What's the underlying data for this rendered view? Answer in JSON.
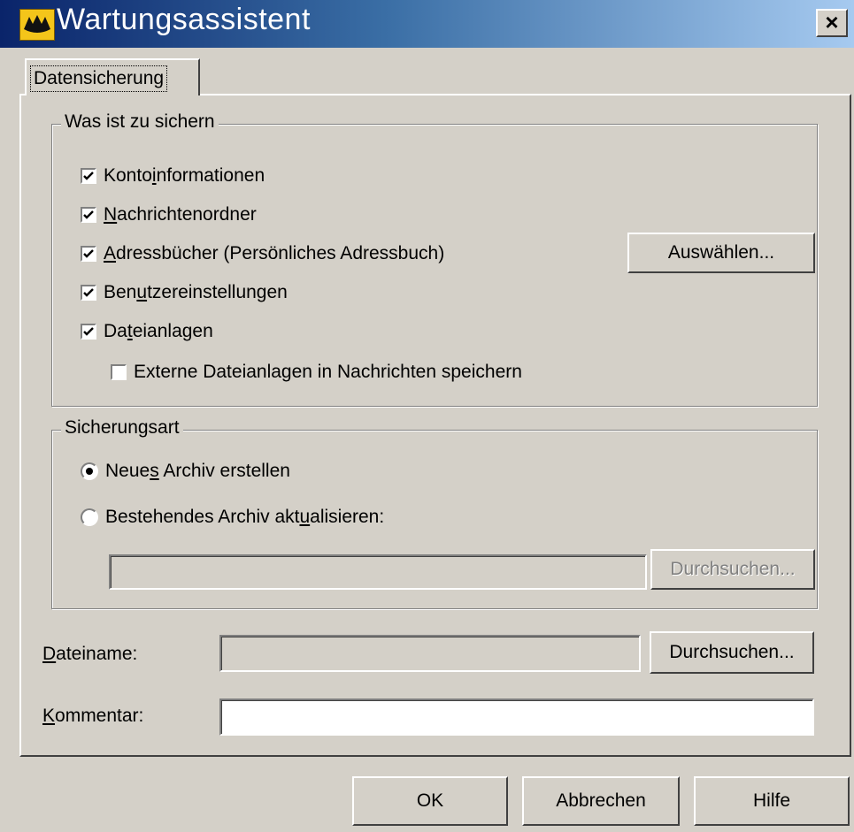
{
  "window": {
    "title": "Wartungsassistent",
    "close_label": "×"
  },
  "tab": {
    "label": "Datensicherung"
  },
  "what_group": {
    "legend": "Was ist zu sichern",
    "items": [
      {
        "pre": "Konto",
        "key": "i",
        "post": "nformationen",
        "checked": true
      },
      {
        "pre": "",
        "key": "N",
        "post": "achrichtenordner",
        "checked": true
      },
      {
        "pre": "",
        "key": "A",
        "post": "dressbücher (Persönliches Adressbuch)",
        "checked": true
      },
      {
        "pre": "Ben",
        "key": "u",
        "post": "tzereinstellungen",
        "checked": true
      },
      {
        "pre": "Da",
        "key": "t",
        "post": "eianlagen",
        "checked": true
      },
      {
        "pre": "Externe Dateianlagen in Nachrichten speichern",
        "key": "",
        "post": "",
        "checked": false
      }
    ],
    "select_button": "Auswählen..."
  },
  "mode_group": {
    "legend": "Sicherungsart",
    "options": [
      {
        "pre": "Neue",
        "key": "s",
        "post": " Archiv erstellen",
        "selected": true
      },
      {
        "pre": "Bestehendes Archiv akt",
        "key": "u",
        "post": "alisieren:",
        "selected": false
      }
    ],
    "archive_path_value": "",
    "browse_button": "Durchsuchen..."
  },
  "filename": {
    "key": "D",
    "rest": "ateiname:",
    "value": "",
    "browse_button": "Durchsuchen..."
  },
  "comment": {
    "key": "K",
    "rest": "ommentar:",
    "value": ""
  },
  "footer": {
    "ok": "OK",
    "cancel": "Abbrechen",
    "help": "Hilfe"
  }
}
